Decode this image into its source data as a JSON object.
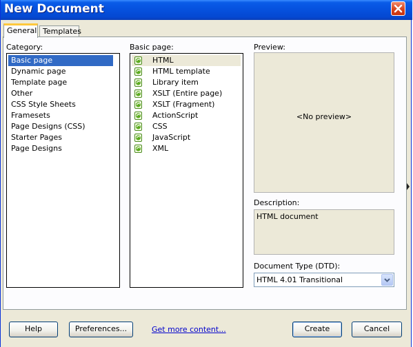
{
  "window": {
    "title": "New Document"
  },
  "tabs": [
    {
      "label": "General",
      "active": true
    },
    {
      "label": "Templates",
      "active": false
    }
  ],
  "category": {
    "label": "Category:",
    "items": [
      "Basic page",
      "Dynamic page",
      "Template page",
      "Other",
      "CSS Style Sheets",
      "Framesets",
      "Page Designs (CSS)",
      "Starter Pages",
      "Page Designs"
    ],
    "selected": "Basic page"
  },
  "basic_page": {
    "label": "Basic page:",
    "items": [
      "HTML",
      "HTML template",
      "Library item",
      "XSLT (Entire page)",
      "XSLT (Fragment)",
      "ActionScript",
      "CSS",
      "JavaScript",
      "XML"
    ],
    "selected": "HTML"
  },
  "preview": {
    "label": "Preview:",
    "text": "<No preview>"
  },
  "description": {
    "label": "Description:",
    "text": "HTML document"
  },
  "doctype": {
    "label": "Document Type (DTD):",
    "value": "HTML 4.01 Transitional"
  },
  "buttons": {
    "help": "Help",
    "preferences": "Preferences...",
    "get_more": "Get more content...",
    "create": "Create",
    "cancel": "Cancel"
  },
  "colors": {
    "title_bar": "#0653e0",
    "selection": "#316ac5",
    "link": "#0000cc",
    "close_button": "#d8431c"
  }
}
